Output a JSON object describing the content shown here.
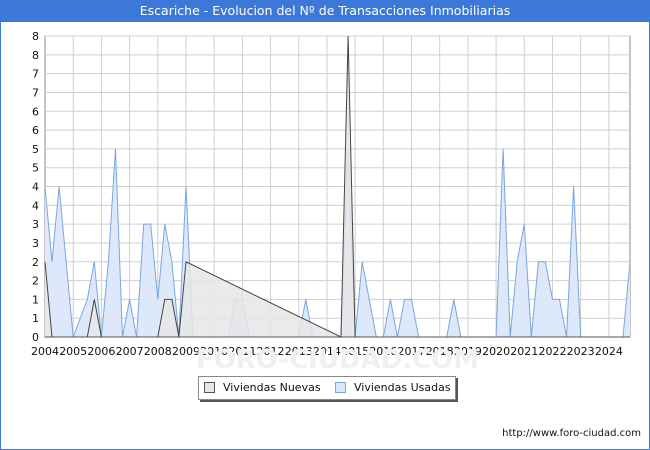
{
  "title": "Escariche - Evolucion del Nº de Transacciones Inmobiliarias",
  "watermark": "FORO-CIUDAD.COM",
  "footer_url": "http://www.foro-ciudad.com",
  "colors": {
    "title_bg": "#3b78d8",
    "new_stroke": "#444444",
    "new_fill": "#e6e6e6",
    "used_stroke": "#7aa6e0",
    "used_fill": "#dde9fa",
    "grid": "#cfcfcf"
  },
  "chart_data": {
    "type": "area",
    "x_tick_labels": [
      "2004",
      "2005",
      "2006",
      "2007",
      "2008",
      "2009",
      "2010",
      "2011",
      "2012",
      "2013",
      "2014",
      "2015",
      "2016",
      "2017",
      "2018",
      "2019",
      "2020",
      "2021",
      "2022",
      "2023",
      "2024"
    ],
    "y_tick_labels": [
      "0",
      "1",
      "1",
      "2",
      "2",
      "3",
      "3",
      "4",
      "4",
      "5",
      "5",
      "6",
      "6",
      "7",
      "7",
      "8",
      "8"
    ],
    "ylim": [
      0,
      8
    ],
    "x_range": [
      2004.0,
      2024.75
    ],
    "grid": true,
    "legend_position": "bottom",
    "series": [
      {
        "name": "Viviendas Nuevas",
        "x": [
          2004.0,
          2004.25,
          2005.5,
          2005.75,
          2006.0,
          2008.0,
          2008.25,
          2008.5,
          2008.75,
          2009.0,
          2014.5,
          2014.75,
          2015.0
        ],
        "values": [
          2,
          0,
          0,
          1,
          0,
          0,
          1,
          1,
          0,
          2,
          0,
          8,
          0
        ]
      },
      {
        "name": "Viviendas Usadas",
        "x": [
          2004.0,
          2004.25,
          2004.5,
          2004.75,
          2005.0,
          2005.5,
          2005.75,
          2006.0,
          2006.25,
          2006.5,
          2006.75,
          2007.0,
          2007.25,
          2007.5,
          2007.75,
          2008.0,
          2008.25,
          2008.5,
          2008.75,
          2009.0,
          2009.25,
          2010.5,
          2010.75,
          2011.0,
          2011.25,
          2013.0,
          2013.25,
          2013.5,
          2014.5,
          2014.75,
          2015.0,
          2015.25,
          2015.5,
          2015.75,
          2016.0,
          2016.25,
          2016.5,
          2016.75,
          2017.0,
          2017.25,
          2017.5,
          2018.25,
          2018.5,
          2018.75,
          2020.0,
          2020.25,
          2020.5,
          2020.75,
          2021.0,
          2021.25,
          2021.5,
          2021.75,
          2022.0,
          2022.25,
          2022.5,
          2022.75,
          2023.0,
          2023.25,
          2023.5,
          2024.5,
          2024.75
        ],
        "values": [
          4,
          2,
          4,
          2,
          0,
          1,
          2,
          0,
          2,
          5,
          0,
          1,
          0,
          3,
          3,
          1,
          3,
          2,
          0,
          4,
          0,
          0,
          1,
          1,
          0,
          0,
          1,
          0,
          0,
          5,
          0,
          2,
          1,
          0,
          0,
          1,
          0,
          1,
          1,
          0,
          0,
          0,
          1,
          0,
          0,
          5,
          0,
          2,
          3,
          0,
          2,
          2,
          1,
          1,
          0,
          4,
          0,
          0,
          0,
          0,
          2
        ]
      }
    ]
  },
  "legend": [
    {
      "label": "Viviendas Nuevas"
    },
    {
      "label": "Viviendas Usadas"
    }
  ]
}
